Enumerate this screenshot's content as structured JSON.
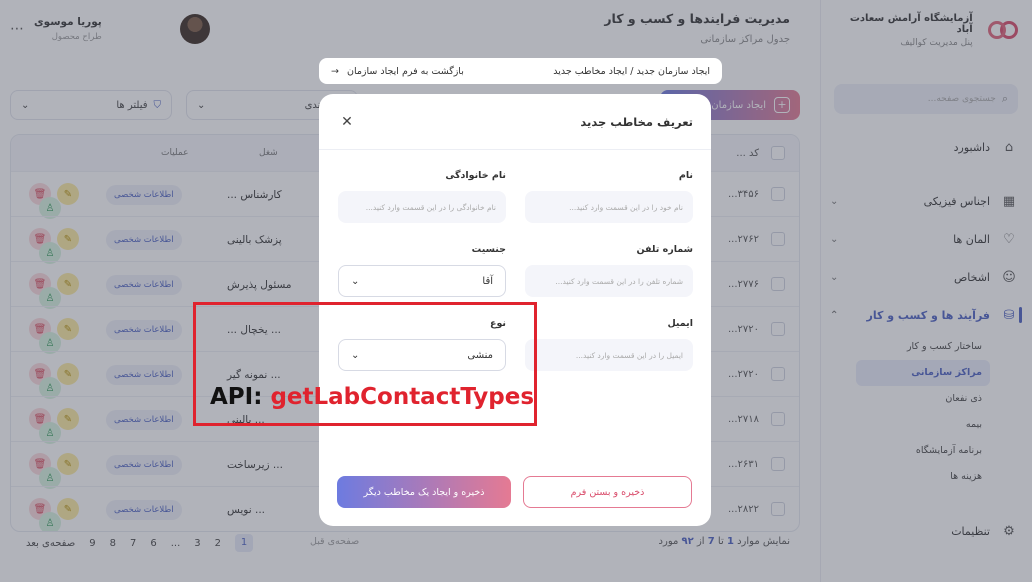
{
  "brand": {
    "title": "آزمایشگاه آرامش سعادت آباد",
    "subtitle": "پنل مدیریت کوالیف"
  },
  "sidebar": {
    "search_placeholder": "جستجوی صفحه...",
    "items": [
      {
        "label": "داشبورد",
        "icon": "home-icon"
      },
      {
        "label": "اجناس فیزیکی",
        "icon": "grid-icon"
      },
      {
        "label": "المان ها",
        "icon": "heart-icon"
      },
      {
        "label": "اشخاص",
        "icon": "people-icon"
      },
      {
        "label": "فرآیند ها و کسب و کار",
        "icon": "database-icon"
      }
    ],
    "sub_items": [
      "ساختار کسب و کار",
      "مراکز سازمانی",
      "ذی نفعان",
      "بیمه",
      "برنامه آزمایشگاه",
      "هزینه ها"
    ],
    "settings_label": "تنظیمات"
  },
  "header": {
    "title": "مدیریت فرایندها و کسب و کار",
    "subtitle": "جدول مراکز سازمانی",
    "user_name": "پوریا موسوی",
    "user_role": "طراح محصول"
  },
  "toolbar": {
    "add_org_label": "ایجاد سازمان",
    "group_label": "گروه بندی",
    "filters_label": "فیلتر ها"
  },
  "table": {
    "headers": {
      "code": "کد ...",
      "job": "شغل",
      "actions": "عملیات"
    },
    "rows": [
      {
        "code": "۳۴۵۶...",
        "job": "کارشناس ...",
        "pill": "اطلاعات شخصی"
      },
      {
        "code": "۲۷۶۲...",
        "job": "پزشک بالینی",
        "pill": "اطلاعات شخصی"
      },
      {
        "code": "۲۷۷۶...",
        "job": "مسئول پذیرش",
        "pill": "اطلاعات شخصی"
      },
      {
        "code": "۲۷۲۰...",
        "job": "... یخچال ...",
        "pill": "اطلاعات شخصی"
      },
      {
        "code": "۲۷۲۰...",
        "job": "... نمونه گیر",
        "pill": "اطلاعات شخصی"
      },
      {
        "code": "۲۷۱۸...",
        "job": "... بالینی",
        "pill": "اطلاعات شخصی"
      },
      {
        "code": "۲۶۳۱...",
        "job": "... زیرساخت",
        "pill": "اطلاعات شخصی"
      },
      {
        "code": "۲۸۲۲...",
        "job": "... نویس",
        "pill": "اطلاعات شخصی"
      }
    ]
  },
  "pagination": {
    "info_prefix": "نمایش موارد",
    "from": "1",
    "to_word": "تا",
    "to": "7",
    "of_word": "از",
    "total": "۹۲",
    "items_word": "مورد",
    "prev_label": "صفحه‌ی قبل",
    "next_label": "صفحه‌ی بعد",
    "pages": [
      "1",
      "2",
      "3",
      "...",
      "6",
      "7",
      "8",
      "9"
    ]
  },
  "breadcrumb": {
    "path": "ایجاد سازمان جدید / ایجاد مخاطب جدید",
    "back_label": "بازگشت به فرم ایجاد سازمان"
  },
  "modal": {
    "title": "تعریف مخاطب جدید",
    "fields": {
      "first_name": {
        "label": "نام",
        "placeholder": "نام خود را در این قسمت وارد کنید..."
      },
      "last_name": {
        "label": "نام خانوادگی",
        "placeholder": "نام خانوادگی را در این قسمت وارد کنید..."
      },
      "phone": {
        "label": "شماره تلفن",
        "placeholder": "شماره تلفن را در این قسمت وارد کنید..."
      },
      "gender": {
        "label": "جنسیت",
        "value": "آقا"
      },
      "email": {
        "label": "ایمیل",
        "placeholder": "ایمیل را در این قسمت وارد کنید..."
      },
      "type": {
        "label": "نوع",
        "value": "منشی"
      }
    },
    "save_close_label": "ذخیره و بستن فرم",
    "save_new_label": "ذخیره و ایجاد یک مخاطب دیگر"
  },
  "annotation": {
    "prefix": "API:",
    "value": "getLabContactTypes",
    "color": "#e0232e"
  },
  "colors": {
    "accent": "#4a5fc1",
    "brand_pink": "#d94b6a"
  }
}
